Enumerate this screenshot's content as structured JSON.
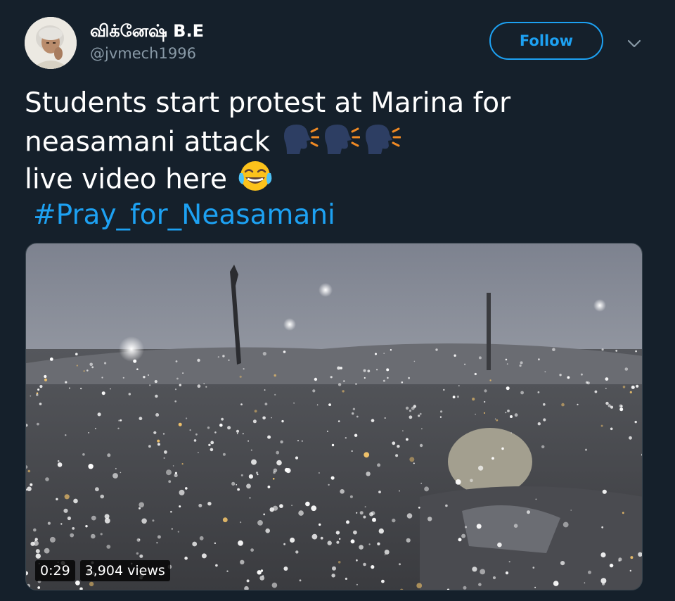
{
  "author": {
    "display_name": "விக்னேஷ் B.E",
    "handle": "@jvmech1996",
    "avatar_icon": "profile-avatar"
  },
  "actions": {
    "follow_label": "Follow",
    "menu_icon": "chevron-down-icon"
  },
  "tweet": {
    "line1": "Students start protest at Marina for",
    "line2": "neasamani attack",
    "line3": "live video here",
    "hashtag": "#Pray_for_Neasamani",
    "line2_emojis": [
      "speaking-head-icon",
      "speaking-head-icon",
      "speaking-head-icon"
    ],
    "line3_emoji": "face-with-tears-of-joy-icon"
  },
  "video": {
    "duration": "0:29",
    "views": "3,904 views"
  },
  "colors": {
    "background": "#15202b",
    "accent": "#1da1f2",
    "secondary_text": "#8899a6"
  }
}
